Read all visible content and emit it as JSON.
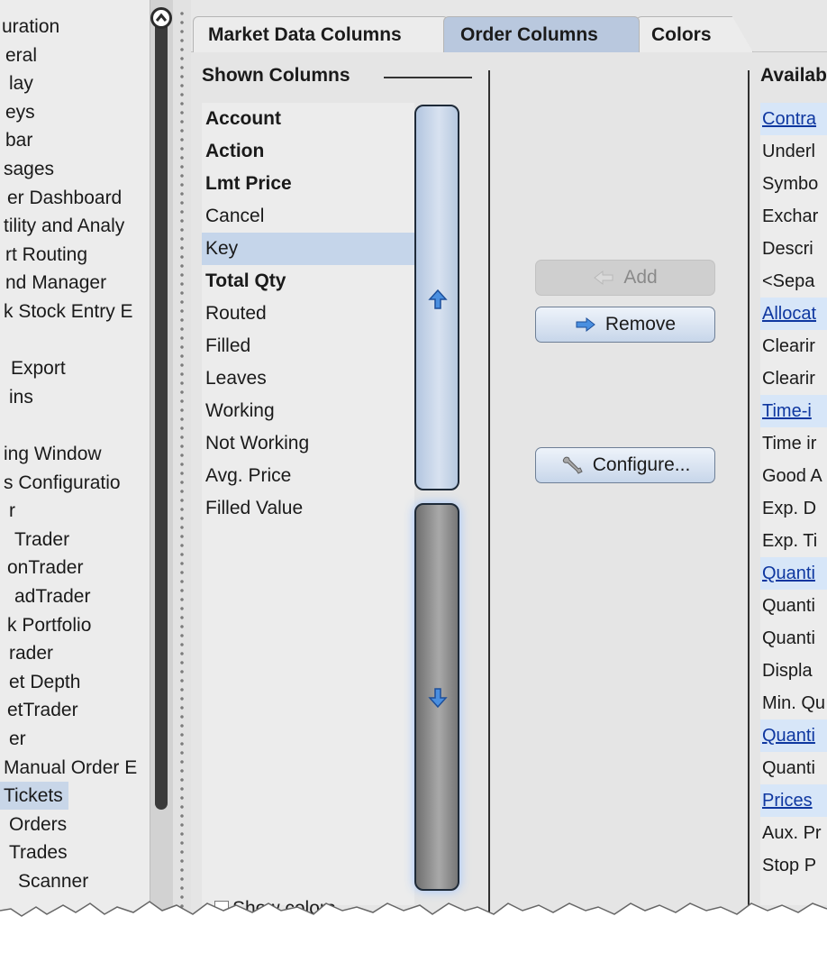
{
  "left_tree": {
    "items": [
      {
        "label": "uration",
        "indent": 2
      },
      {
        "label": "eral",
        "indent": 6
      },
      {
        "label": "lay",
        "indent": 10
      },
      {
        "label": "eys",
        "indent": 6
      },
      {
        "label": "bar",
        "indent": 6
      },
      {
        "label": "sages",
        "indent": 4
      },
      {
        "label": "er Dashboard",
        "indent": 8
      },
      {
        "label": "tility and Analy",
        "indent": 4
      },
      {
        "label": "rt Routing",
        "indent": 6
      },
      {
        "label": "nd Manager",
        "indent": 6
      },
      {
        "label": "k Stock Entry E",
        "indent": 4
      },
      {
        "label": "",
        "indent": 0
      },
      {
        "label": "Export",
        "indent": 12
      },
      {
        "label": "ins",
        "indent": 10
      },
      {
        "label": "",
        "indent": 0
      },
      {
        "label": "ing Window",
        "indent": 4
      },
      {
        "label": "s Configuratio",
        "indent": 4
      },
      {
        "label": "r",
        "indent": 10
      },
      {
        "label": "Trader",
        "indent": 16
      },
      {
        "label": "onTrader",
        "indent": 8
      },
      {
        "label": "adTrader",
        "indent": 16
      },
      {
        "label": "k Portfolio",
        "indent": 8
      },
      {
        "label": "rader",
        "indent": 10
      },
      {
        "label": "et Depth",
        "indent": 10
      },
      {
        "label": "etTrader",
        "indent": 8
      },
      {
        "label": "er",
        "indent": 10
      },
      {
        "label": "Manual Order E",
        "indent": 4
      },
      {
        "label": "Tickets",
        "indent": 4,
        "selected": true
      },
      {
        "label": "Orders",
        "indent": 10
      },
      {
        "label": "Trades",
        "indent": 10
      },
      {
        "label": "Scanner",
        "indent": 20
      }
    ]
  },
  "tabs": [
    {
      "label": "Market Data Columns",
      "active": false
    },
    {
      "label": "Order Columns",
      "active": true
    },
    {
      "label": "Colors",
      "active": false
    }
  ],
  "shown_columns": {
    "header": "Shown Columns",
    "items": [
      {
        "label": "Account",
        "bold": true,
        "selected": false
      },
      {
        "label": "Action",
        "bold": true,
        "selected": false
      },
      {
        "label": "Lmt Price",
        "bold": true,
        "selected": false
      },
      {
        "label": "Cancel",
        "bold": false,
        "selected": false
      },
      {
        "label": "Key",
        "bold": false,
        "selected": true
      },
      {
        "label": "Total Qty",
        "bold": true,
        "selected": false
      },
      {
        "label": "Routed",
        "bold": false,
        "selected": false
      },
      {
        "label": "Filled",
        "bold": false,
        "selected": false
      },
      {
        "label": "Leaves",
        "bold": false,
        "selected": false
      },
      {
        "label": "Working",
        "bold": false,
        "selected": false
      },
      {
        "label": "Not Working",
        "bold": false,
        "selected": false
      },
      {
        "label": "Avg. Price",
        "bold": false,
        "selected": false
      },
      {
        "label": "Filled Value",
        "bold": false,
        "selected": false
      }
    ],
    "show_colors_label": "Show colors"
  },
  "actions": {
    "add_label": "Add",
    "remove_label": "Remove",
    "configure_label": "Configure..."
  },
  "available_columns": {
    "header": "Availab",
    "items": [
      {
        "label": "Contra",
        "group": true
      },
      {
        "label": "Underl",
        "group": false
      },
      {
        "label": "Symbo",
        "group": false
      },
      {
        "label": "Exchar",
        "group": false
      },
      {
        "label": "Descri",
        "group": false
      },
      {
        "label": "<Sepa",
        "group": false
      },
      {
        "label": "Allocat",
        "group": true
      },
      {
        "label": "Clearir",
        "group": false
      },
      {
        "label": "Clearir",
        "group": false
      },
      {
        "label": "Time-i",
        "group": true
      },
      {
        "label": "Time ir",
        "group": false
      },
      {
        "label": "Good A",
        "group": false
      },
      {
        "label": "Exp. D",
        "group": false
      },
      {
        "label": "Exp. Ti",
        "group": false
      },
      {
        "label": "Quanti",
        "group": true
      },
      {
        "label": "Quanti",
        "group": false
      },
      {
        "label": "Quanti",
        "group": false
      },
      {
        "label": "Displa",
        "group": false
      },
      {
        "label": "Min. Qu",
        "group": false
      },
      {
        "label": "Quanti",
        "group": true
      },
      {
        "label": "Quanti",
        "group": false
      },
      {
        "label": "Prices",
        "group": true
      },
      {
        "label": "Aux. Pr",
        "group": false
      },
      {
        "label": "Stop P",
        "group": false
      }
    ]
  },
  "icons": {
    "scroll_up": "chevron-up-icon",
    "move_up": "arrow-up-icon",
    "move_down": "arrow-down-icon",
    "add": "arrow-left-icon",
    "remove": "arrow-right-icon",
    "configure": "wrench-icon"
  },
  "colors": {
    "active_tab": "#b9c8de",
    "selected_row": "#c5d5ea",
    "group_row": "#d7e6f8",
    "group_text": "#0e37a0"
  }
}
